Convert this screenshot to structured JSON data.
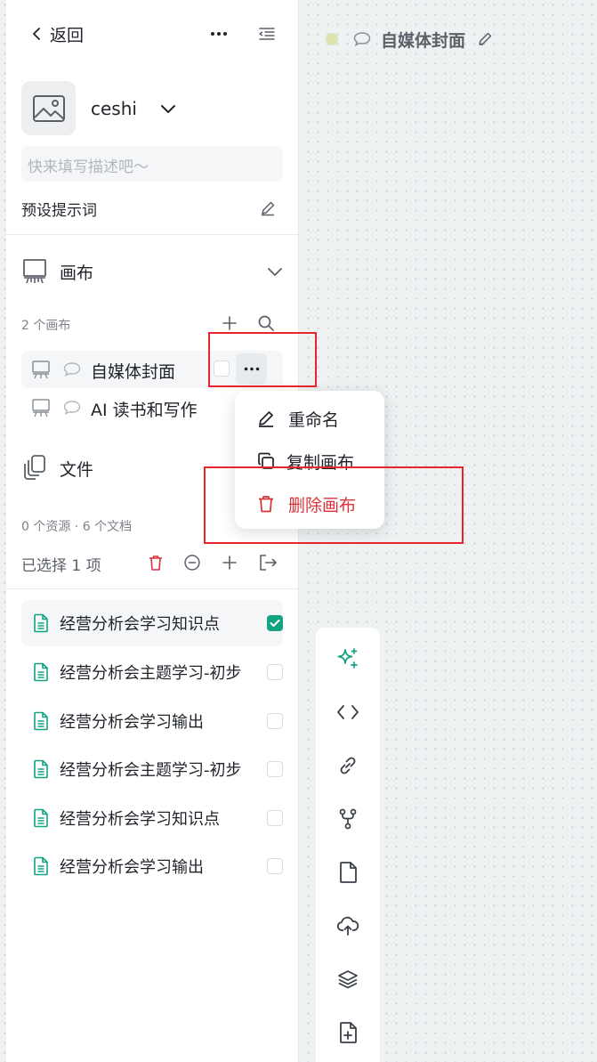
{
  "header": {
    "back_label": "返回"
  },
  "project": {
    "name": "ceshi",
    "description_placeholder": "快来填写描述吧～",
    "preset_label": "预设提示词"
  },
  "canvas_section": {
    "title": "画布",
    "count_label": "2 个画布",
    "items": [
      {
        "title": "自媒体封面"
      },
      {
        "title": "AI 读书和写作"
      }
    ]
  },
  "context_menu": {
    "rename": "重命名",
    "duplicate": "复制画布",
    "delete": "删除画布"
  },
  "files_section": {
    "title": "文件",
    "stats_label": "0 个资源 · 6 个文档",
    "selected_label": "已选择 1 项",
    "items": [
      {
        "title": "经营分析会学习知识点",
        "checked": true
      },
      {
        "title": "经营分析会主题学习-初步",
        "checked": false
      },
      {
        "title": "经营分析会学习输出",
        "checked": false
      },
      {
        "title": "经营分析会主题学习-初步",
        "checked": false
      },
      {
        "title": "经营分析会学习知识点",
        "checked": false
      },
      {
        "title": "经营分析会学习输出",
        "checked": false
      }
    ]
  },
  "canvas_header": {
    "title": "自媒体封面"
  },
  "right_toolbar": {
    "tools": [
      "sparkle-icon",
      "code-icon",
      "link-icon",
      "branch-icon",
      "file-icon",
      "cloud-upload-icon",
      "layers-icon",
      "file-plus-icon"
    ]
  },
  "colors": {
    "accent": "#12a383",
    "danger": "#d9323a",
    "highlight_rect": "#e8242c"
  }
}
